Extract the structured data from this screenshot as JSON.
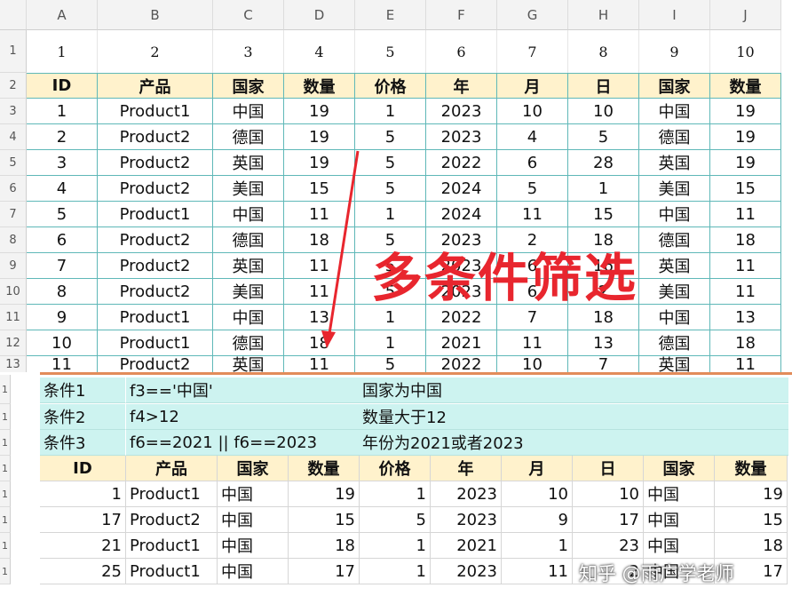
{
  "columns": [
    "A",
    "B",
    "C",
    "D",
    "E",
    "F",
    "G",
    "H",
    "I",
    "J"
  ],
  "row_numbers": [
    "1",
    "2",
    "3",
    "4",
    "5",
    "6",
    "7",
    "8",
    "9",
    "10",
    "11",
    "12",
    "13"
  ],
  "index_row": [
    "1",
    "2",
    "3",
    "4",
    "5",
    "6",
    "7",
    "8",
    "9",
    "10"
  ],
  "headers": [
    "ID",
    "产品",
    "国家",
    "数量",
    "价格",
    "年",
    "月",
    "日",
    "国家",
    "数量"
  ],
  "rows": [
    [
      "1",
      "Product1",
      "中国",
      "19",
      "1",
      "2023",
      "10",
      "10",
      "中国",
      "19"
    ],
    [
      "2",
      "Product2",
      "德国",
      "19",
      "5",
      "2023",
      "4",
      "5",
      "德国",
      "19"
    ],
    [
      "3",
      "Product2",
      "英国",
      "19",
      "5",
      "2022",
      "6",
      "28",
      "英国",
      "19"
    ],
    [
      "4",
      "Product2",
      "美国",
      "15",
      "5",
      "2024",
      "5",
      "1",
      "美国",
      "15"
    ],
    [
      "5",
      "Product1",
      "中国",
      "11",
      "1",
      "2024",
      "11",
      "15",
      "中国",
      "11"
    ],
    [
      "6",
      "Product2",
      "德国",
      "18",
      "5",
      "2023",
      "2",
      "18",
      "德国",
      "18"
    ],
    [
      "7",
      "Product2",
      "英国",
      "11",
      "5",
      "2023",
      "6",
      "16",
      "英国",
      "11"
    ],
    [
      "8",
      "Product2",
      "美国",
      "11",
      "5",
      "2023",
      "6",
      "2",
      "美国",
      "11"
    ],
    [
      "9",
      "Product1",
      "中国",
      "13",
      "1",
      "2022",
      "7",
      "18",
      "中国",
      "13"
    ],
    [
      "10",
      "Product1",
      "德国",
      "18",
      "1",
      "2021",
      "11",
      "13",
      "德国",
      "18"
    ],
    [
      "11",
      "Product2",
      "英国",
      "11",
      "5",
      "2022",
      "10",
      "7",
      "英国",
      "11"
    ]
  ],
  "conditions": [
    {
      "label": "条件1",
      "expr": "f3=='中国'",
      "desc": "国家为中国"
    },
    {
      "label": "条件2",
      "expr": "f4>12",
      "desc": "数量大于12"
    },
    {
      "label": "条件3",
      "expr": "f6==2021 || f6==2023",
      "desc": "年份为2021或者2023"
    }
  ],
  "result_headers": [
    "ID",
    "产品",
    "国家",
    "数量",
    "价格",
    "年",
    "月",
    "日",
    "国家",
    "数量"
  ],
  "results": [
    [
      "1",
      "Product1",
      "中国",
      "19",
      "1",
      "2023",
      "10",
      "10",
      "中国",
      "19"
    ],
    [
      "17",
      "Product2",
      "中国",
      "15",
      "5",
      "2023",
      "9",
      "17",
      "中国",
      "15"
    ],
    [
      "21",
      "Product1",
      "中国",
      "18",
      "1",
      "2021",
      "1",
      "23",
      "中国",
      "18"
    ],
    [
      "25",
      "Product1",
      "中国",
      "17",
      "1",
      "2023",
      "11",
      "2",
      "中国",
      "17"
    ]
  ],
  "overlay_title": "多条件筛选",
  "watermark": "知乎 @雨广学老师",
  "colors": {
    "header_fill": "#fff2cc",
    "condition_fill": "#cdf3f0",
    "grid": "#5fb8b8",
    "overlay": "#e8262e"
  }
}
